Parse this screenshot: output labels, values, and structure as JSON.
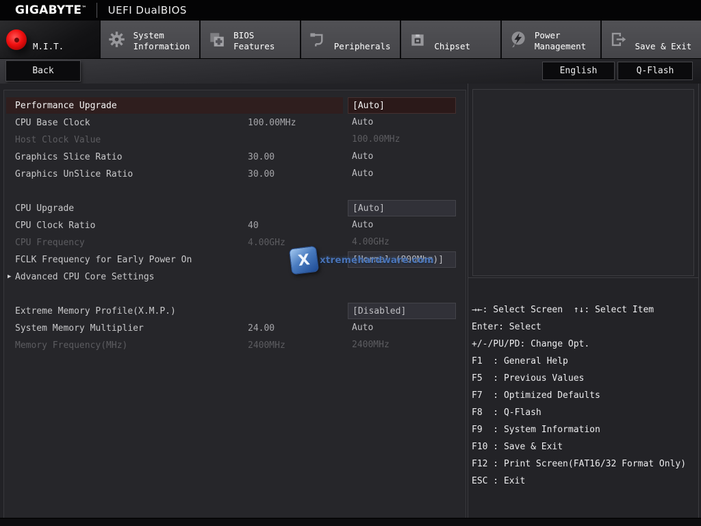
{
  "header": {
    "brand": "GIGABYTE",
    "brand_tm": "™",
    "title": "UEFI DualBIOS"
  },
  "tabbar": {
    "tabs": [
      {
        "id": "mit",
        "label_lines": [
          "M.I.T."
        ],
        "icon": "mit-red-dot-icon",
        "active": true
      },
      {
        "id": "system-information",
        "label_lines": [
          "System",
          "Information"
        ],
        "icon": "gear-icon",
        "active": false
      },
      {
        "id": "bios-features",
        "label_lines": [
          "BIOS",
          "Features"
        ],
        "icon": "bios-chip-plus-icon",
        "active": false
      },
      {
        "id": "peripherals",
        "label_lines": [
          "Peripherals"
        ],
        "icon": "peripherals-icon",
        "active": false
      },
      {
        "id": "chipset",
        "label_lines": [
          "Chipset"
        ],
        "icon": "chipset-icon",
        "active": false
      },
      {
        "id": "power-management",
        "label_lines": [
          "Power",
          "Management"
        ],
        "icon": "power-bolt-icon",
        "active": false
      },
      {
        "id": "save-exit",
        "label_lines": [
          "Save & Exit"
        ],
        "icon": "save-exit-icon",
        "active": false
      }
    ]
  },
  "toolbar": {
    "back_label": "Back",
    "language_label": "English",
    "qflash_label": "Q-Flash"
  },
  "settings": {
    "expand_marker": "▶",
    "sections": [
      {
        "rows": [
          {
            "label": "Performance Upgrade",
            "mid": "",
            "value": "[Auto]",
            "state": "selected",
            "boxed": true
          },
          {
            "label": "CPU Base Clock",
            "mid": "100.00MHz",
            "value": "Auto",
            "state": "normal",
            "boxed": false
          },
          {
            "label": "Host Clock Value",
            "mid": "",
            "value": "100.00MHz",
            "state": "disabled",
            "boxed": false
          },
          {
            "label": "Graphics Slice Ratio",
            "mid": "30.00",
            "value": "Auto",
            "state": "normal",
            "boxed": false
          },
          {
            "label": "Graphics UnSlice Ratio",
            "mid": "30.00",
            "value": "Auto",
            "state": "normal",
            "boxed": false
          }
        ]
      },
      {
        "rows": [
          {
            "label": "CPU Upgrade",
            "mid": "",
            "value": "[Auto]",
            "state": "normal",
            "boxed": true
          },
          {
            "label": "CPU Clock Ratio",
            "mid": "40",
            "value": "Auto",
            "state": "normal",
            "boxed": false
          },
          {
            "label": "CPU Frequency",
            "mid": "4.00GHz",
            "value": "4.00GHz",
            "state": "disabled",
            "boxed": false
          },
          {
            "label": "FCLK Frequency for Early Power On",
            "mid": "",
            "value": "[Normal (800Mhz)]",
            "state": "normal",
            "boxed": true
          },
          {
            "label": "Advanced CPU Core Settings",
            "mid": "",
            "value": "",
            "state": "normal",
            "boxed": false,
            "expandable": true
          }
        ]
      },
      {
        "rows": [
          {
            "label": "Extreme Memory Profile(X.M.P.)",
            "mid": "",
            "value": "[Disabled]",
            "state": "normal",
            "boxed": true
          },
          {
            "label": "System Memory Multiplier",
            "mid": "24.00",
            "value": "Auto",
            "state": "normal",
            "boxed": false
          },
          {
            "label": "Memory Frequency(MHz)",
            "mid": "2400MHz",
            "value": "2400MHz",
            "state": "disabled",
            "boxed": false
          }
        ]
      }
    ]
  },
  "help": {
    "lines": [
      "→←: Select Screen  ↑↓: Select Item",
      "Enter: Select",
      "+/-/PU/PD: Change Opt.",
      "F1  : General Help",
      "F5  : Previous Values",
      "F7  : Optimized Defaults",
      "F8  : Q-Flash",
      "F9  : System Information",
      "F10 : Save & Exit",
      "F12 : Print Screen(FAT16/32 Format Only)",
      "ESC : Exit"
    ]
  },
  "watermark": {
    "text": "xtremehardware.com",
    "x_label": "X"
  },
  "colors": {
    "accent_red": "#ef0f0f",
    "selected_row_bg": "#2f1e1e",
    "tab_gray": "#4a4a4e",
    "content_bg": "#26262a",
    "boxed_value_bg": "#313138",
    "help_text": "#ececee",
    "watermark_blue": "#4a74b8"
  }
}
